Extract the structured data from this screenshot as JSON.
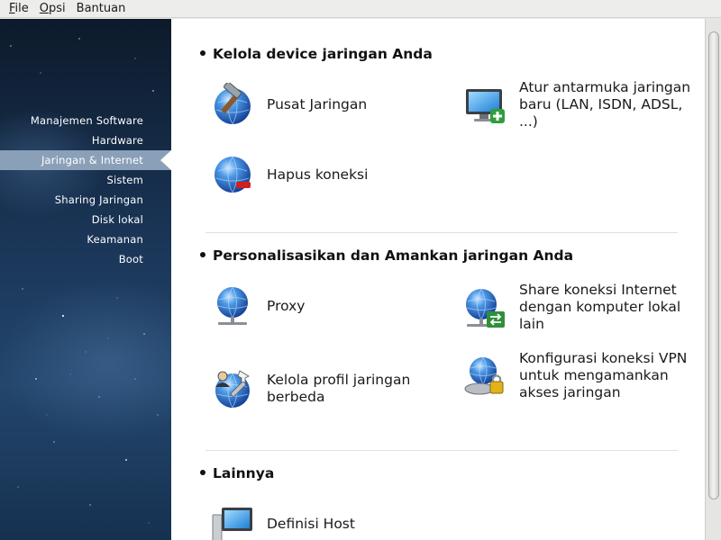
{
  "menubar": {
    "items": [
      {
        "label_first": "F",
        "label_rest": "ile"
      },
      {
        "label_first": "O",
        "label_rest": "psi"
      },
      {
        "label_first": "",
        "label_rest": "Bantuan"
      }
    ]
  },
  "sidebar": {
    "items": [
      {
        "label": "Manajemen Software",
        "active": false
      },
      {
        "label": "Hardware",
        "active": false
      },
      {
        "label": "Jaringan & Internet",
        "active": true
      },
      {
        "label": "Sistem",
        "active": false
      },
      {
        "label": "Sharing Jaringan",
        "active": false
      },
      {
        "label": "Disk lokal",
        "active": false
      },
      {
        "label": "Keamanan",
        "active": false
      },
      {
        "label": "Boot",
        "active": false
      }
    ]
  },
  "sections": [
    {
      "title": "Kelola device jaringan Anda",
      "tools": [
        {
          "label": "Pusat Jaringan",
          "icon": "hammer-globe-icon"
        },
        {
          "label": "Atur antarmuka jaringan baru (LAN, ISDN, ADSL, ...)",
          "icon": "monitor-plus-icon"
        },
        {
          "label": "Hapus koneksi",
          "icon": "globe-remove-icon"
        }
      ]
    },
    {
      "title": "Personalisasikan dan Amankan jaringan Anda",
      "tools": [
        {
          "label": "Proxy",
          "icon": "globe-network-icon"
        },
        {
          "label": "Share koneksi Internet dengan komputer lokal lain",
          "icon": "globe-share-icon"
        },
        {
          "label": "Kelola profil jaringan berbeda",
          "icon": "globe-profile-icon"
        },
        {
          "label": "Konfigurasi koneksi VPN untuk mengamankan akses jaringan",
          "icon": "globe-vpn-lock-icon"
        }
      ]
    },
    {
      "title": "Lainnya",
      "tools": [
        {
          "label": "Definisi Host",
          "icon": "computer-hosts-icon"
        }
      ]
    }
  ],
  "colors": {
    "sidebar_active": "#8aa0b8",
    "globe_blue": "#2a6fd0",
    "sidebar_dark": "#0d1a2b"
  }
}
